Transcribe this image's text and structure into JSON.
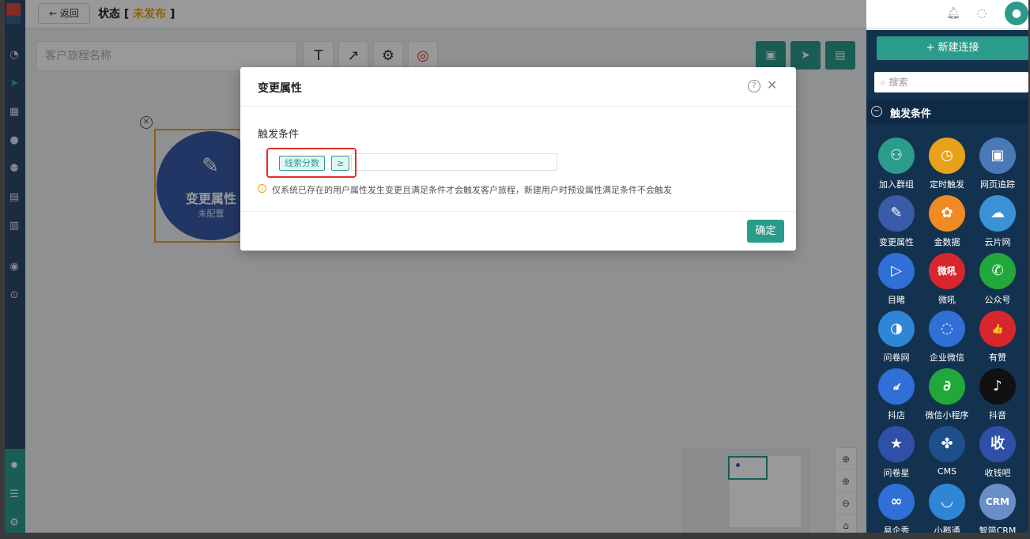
{
  "topbar": {
    "back_label": "← 返回",
    "status_label": "状态 [",
    "status_value": "未发布",
    "status_end": "]"
  },
  "canvas": {
    "journey_name_placeholder": "客户旅程名称",
    "tools": [
      "T",
      "↗",
      "⚙",
      "◎"
    ],
    "node": {
      "title": "变更属性",
      "subtitle": "未配置"
    }
  },
  "modal": {
    "title": "变更属性",
    "section_label": "触发条件",
    "tags": [
      "线索分数",
      "≥"
    ],
    "hint": "仅系统已存在的用户属性发生变更且满足条件才会触发客户旅程，新建用户时预设属性满足条件不会触发",
    "ok_label": "确定"
  },
  "panel": {
    "new_connection_label": "+ 新建连接",
    "search_placeholder": "搜索",
    "section_title": "触发条件",
    "items": [
      {
        "label": "加入群组",
        "icon": "person-add-icon",
        "glyph": "⚇",
        "color": "#2b9b8c"
      },
      {
        "label": "定时触发",
        "icon": "clock-icon",
        "glyph": "◷",
        "color": "#e8a11a"
      },
      {
        "label": "网页追踪",
        "icon": "window-icon",
        "glyph": "▣",
        "color": "#4a79b8"
      },
      {
        "label": "变更属性",
        "icon": "edit-icon",
        "glyph": "✎",
        "color": "#3a5ba8"
      },
      {
        "label": "金数据",
        "icon": "sprout-icon",
        "glyph": "✿",
        "color": "#f08a22"
      },
      {
        "label": "云片网",
        "icon": "cloud-icon",
        "glyph": "☁",
        "color": "#3a92d6"
      },
      {
        "label": "目睹",
        "icon": "play-icon",
        "glyph": "▷",
        "color": "#2f6fd6"
      },
      {
        "label": "微吼",
        "icon": "weihou-icon",
        "glyph": "微吼",
        "color": "#d8262d"
      },
      {
        "label": "公众号",
        "icon": "wechat-icon",
        "glyph": "✆",
        "color": "#22a83a"
      },
      {
        "label": "问卷网",
        "icon": "survey-icon",
        "glyph": "◑",
        "color": "#2f86d6"
      },
      {
        "label": "企业微信",
        "icon": "chat-bubble-icon",
        "glyph": "◌",
        "color": "#2f6fd6"
      },
      {
        "label": "有赞",
        "icon": "thumbs-up-icon",
        "glyph": "👍",
        "color": "#d8262d"
      },
      {
        "label": "抖店",
        "icon": "doudian-icon",
        "glyph": "𝓭",
        "color": "#2f6fd6"
      },
      {
        "label": "微信小程序",
        "icon": "link-icon",
        "glyph": "∂",
        "color": "#22a83a"
      },
      {
        "label": "抖音",
        "icon": "tiktok-icon",
        "glyph": "♪",
        "color": "#111111"
      },
      {
        "label": "问卷星",
        "icon": "star-icon",
        "glyph": "★",
        "color": "#2f4fa8"
      },
      {
        "label": "CMS",
        "icon": "cms-icon",
        "glyph": "✤",
        "color": "#1f4f8a"
      },
      {
        "label": "收钱吧",
        "icon": "shouqianba-icon",
        "glyph": "收",
        "color": "#2f4fa8"
      },
      {
        "label": "易企秀",
        "icon": "infinity-icon",
        "glyph": "∞",
        "color": "#2f6fd6"
      },
      {
        "label": "小鹅通",
        "icon": "goose-icon",
        "glyph": "◡",
        "color": "#2f86d6"
      },
      {
        "label": "智简CRM",
        "icon": "crm-icon",
        "glyph": "CRM",
        "color": "#6a8fc8"
      }
    ]
  }
}
